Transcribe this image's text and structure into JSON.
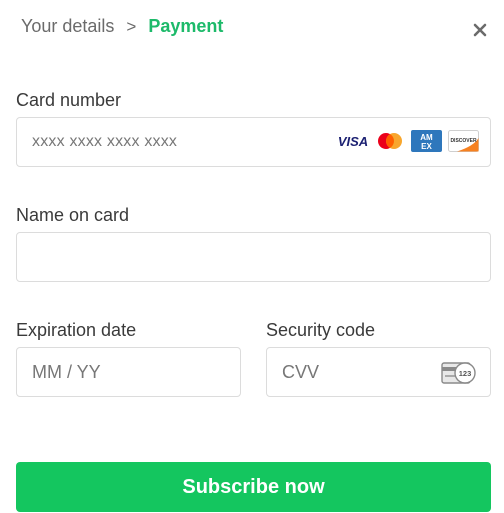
{
  "breadcrumb": {
    "previous": "Your details",
    "separator": ">",
    "current": "Payment"
  },
  "close": {
    "icon": "close-icon"
  },
  "card_number": {
    "label": "Card number",
    "placeholder": "xxxx xxxx xxxx xxxx",
    "brands": [
      {
        "name": "visa",
        "text": "VISA",
        "color": "#1a1f71"
      },
      {
        "name": "mastercard",
        "colors": [
          "#eb001b",
          "#f79e1b"
        ]
      },
      {
        "name": "amex",
        "text": "AM EX",
        "color": "#2e77bc"
      },
      {
        "name": "discover",
        "text": "DISCOVER",
        "color": "#f68121"
      }
    ]
  },
  "name_on_card": {
    "label": "Name on card",
    "placeholder": ""
  },
  "expiration": {
    "label": "Expiration date",
    "placeholder": "MM / YY"
  },
  "security_code": {
    "label": "Security code",
    "placeholder": "CVV",
    "icon_text": "123"
  },
  "submit": {
    "label": "Subscribe now",
    "color": "#14c65f"
  },
  "accent_color": "#1dba6a"
}
